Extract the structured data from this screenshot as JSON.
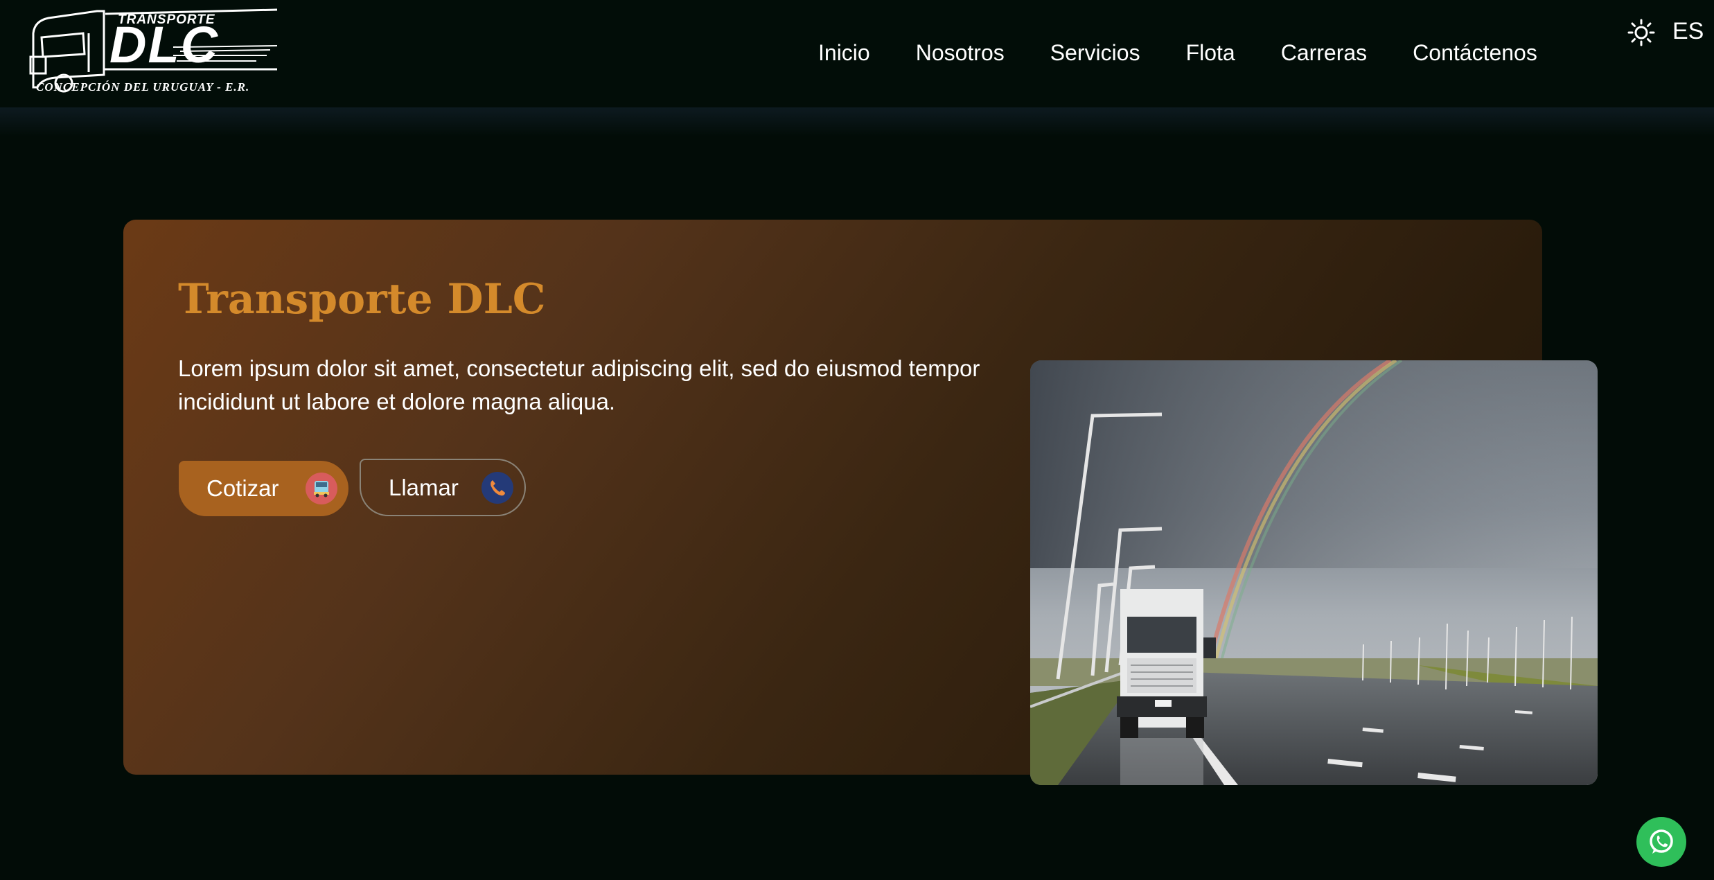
{
  "header": {
    "logo": {
      "top_text": "TRANSPORTE",
      "main_text": "DLC",
      "bottom_text": "CONCEPCIÓN DEL URUGUAY - E.R."
    },
    "nav": [
      {
        "label": "Inicio"
      },
      {
        "label": "Nosotros"
      },
      {
        "label": "Servicios"
      },
      {
        "label": "Flota"
      },
      {
        "label": "Carreras"
      },
      {
        "label": "Contáctenos"
      }
    ],
    "theme_icon": "sun-icon",
    "language": "ES"
  },
  "hero": {
    "title": "Transporte DLC",
    "description": "Lorem ipsum dolor sit amet, consectetur adipiscing elit, sed do eiusmod tempor incididunt ut labore et dolore magna aliqua.",
    "buttons": {
      "cotizar": {
        "label": "Cotizar",
        "icon": "truck-icon"
      },
      "llamar": {
        "label": "Llamar",
        "icon": "phone-icon"
      }
    },
    "image_icon": "truck-rainbow-photo"
  },
  "floating": {
    "whatsapp_icon": "whatsapp-icon"
  },
  "colors": {
    "background": "#020c07",
    "accent_title": "#d48a2b",
    "cotizar_button": "#a8621f",
    "whatsapp": "#2fbf5a"
  }
}
